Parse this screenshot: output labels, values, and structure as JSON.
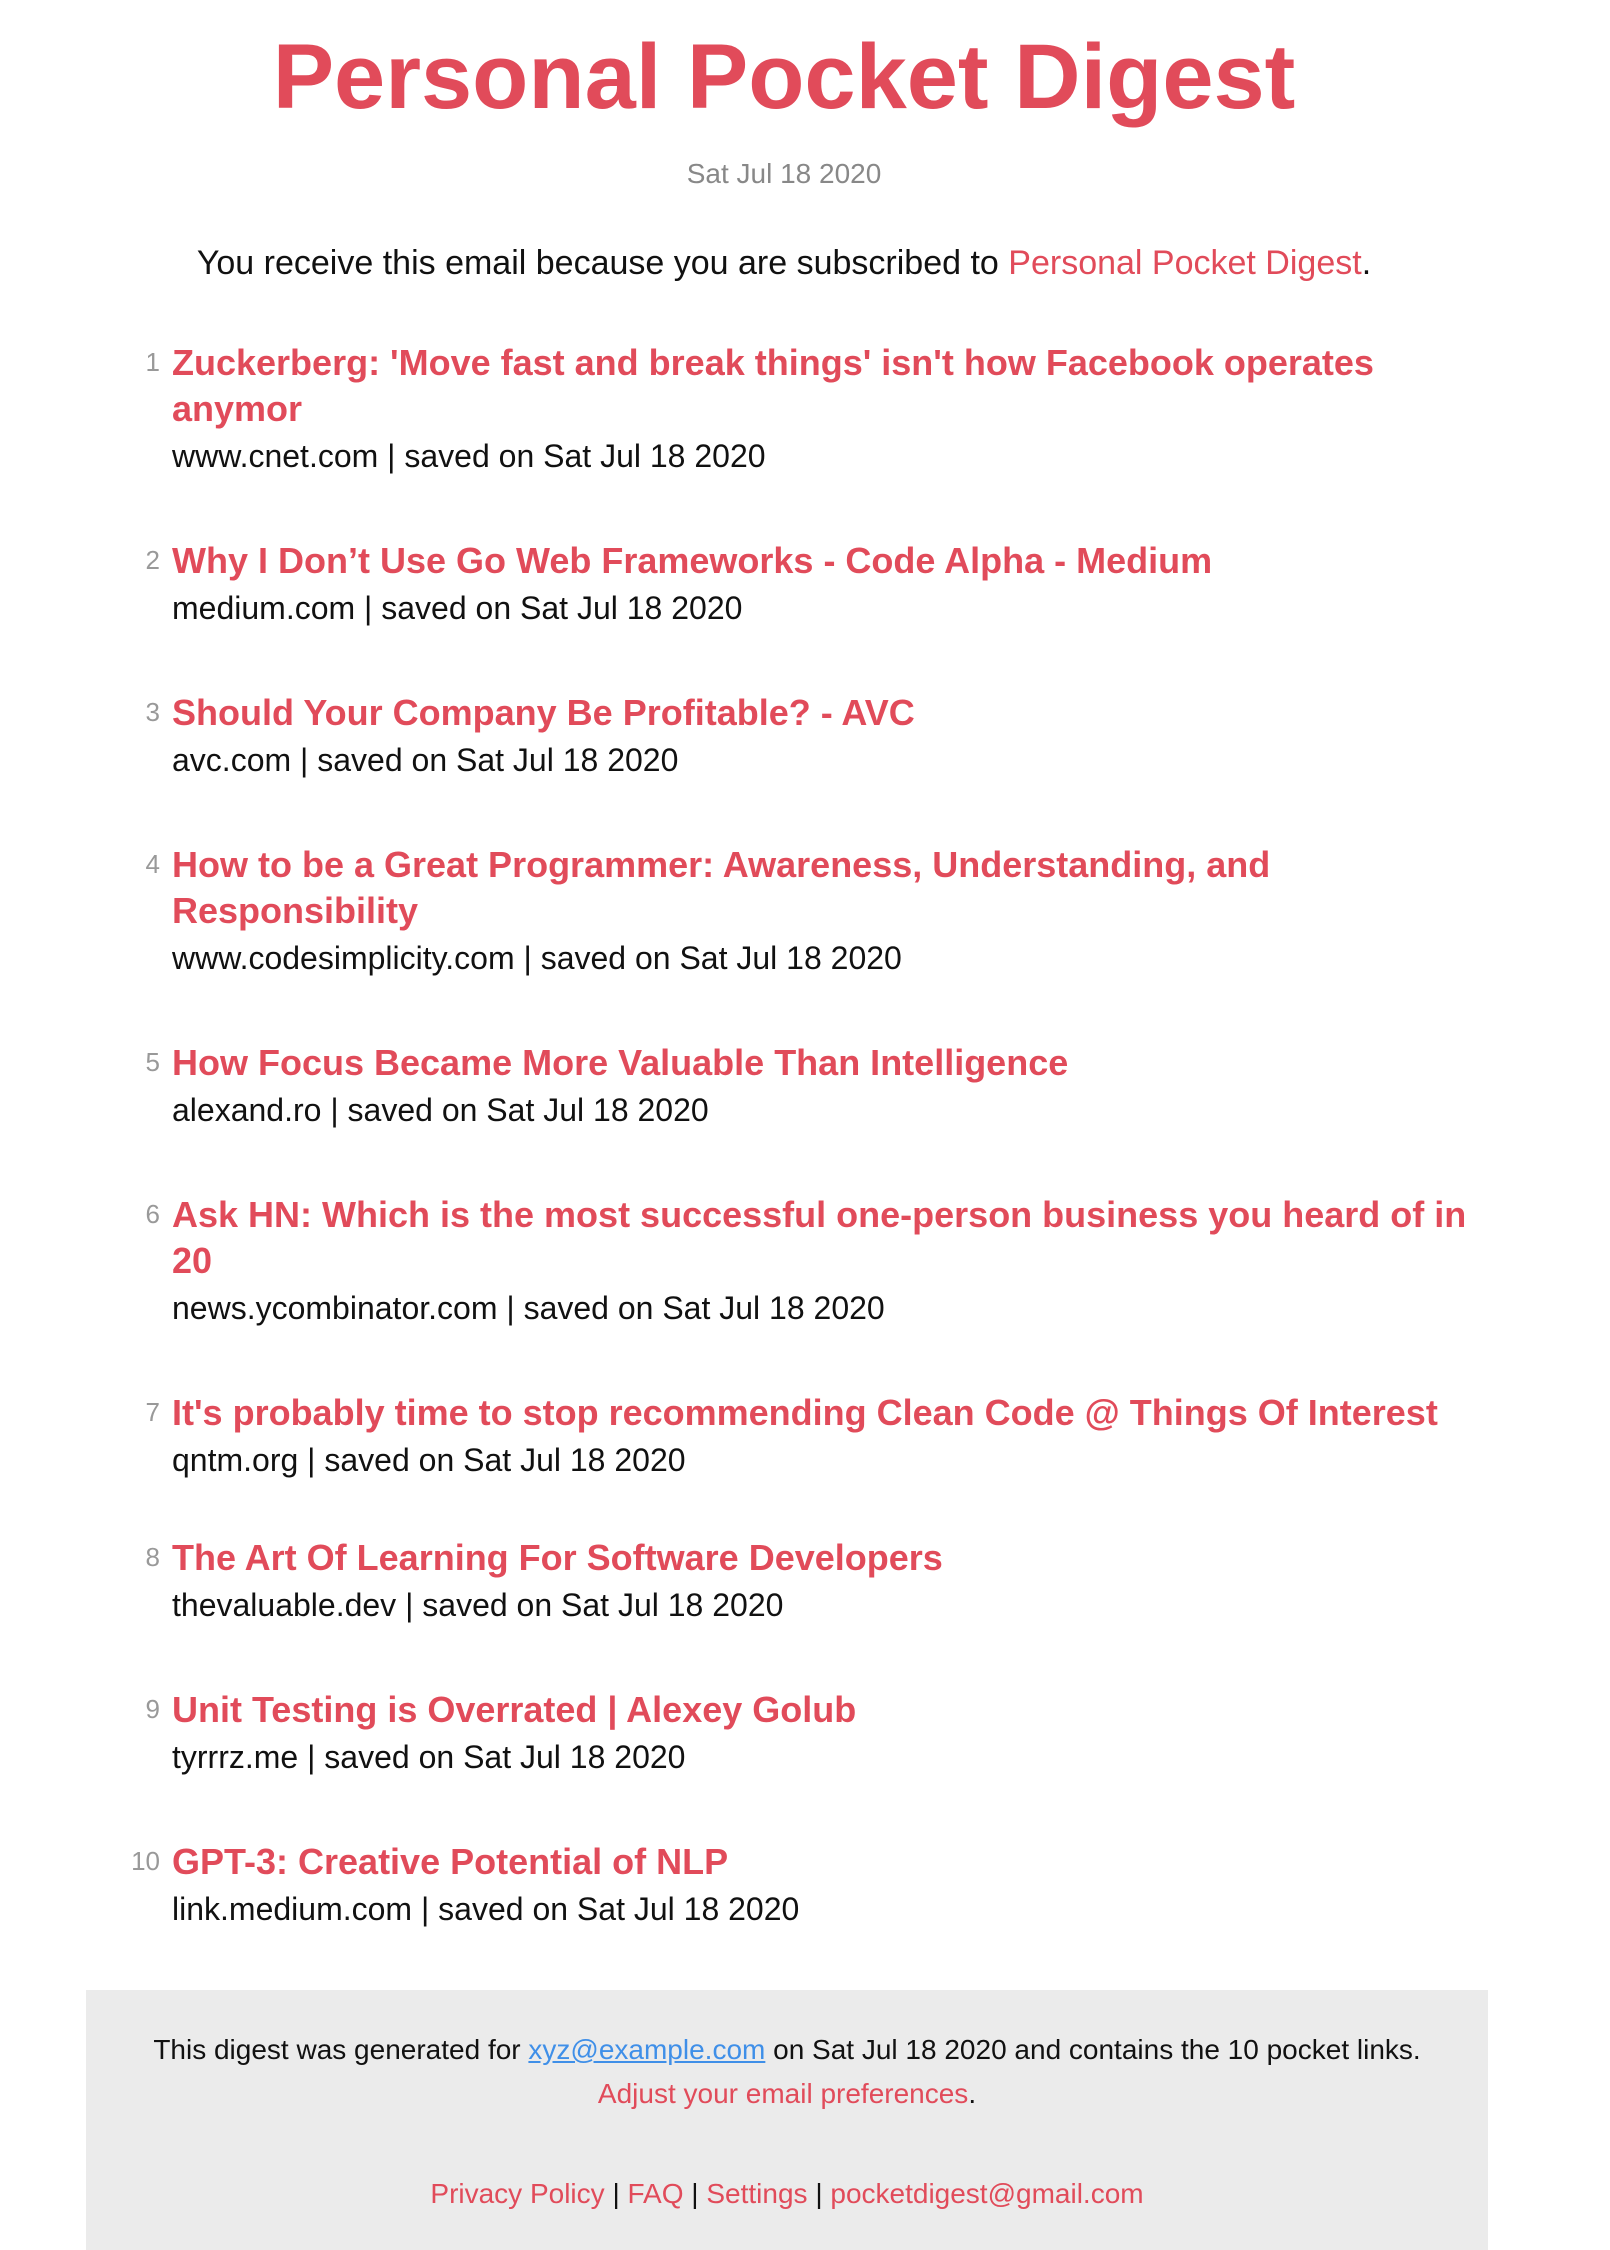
{
  "header": {
    "title": "Personal Pocket Digest",
    "date": "Sat Jul 18 2020"
  },
  "intro": {
    "prefix": "You receive this email because you are subscribed to ",
    "link_label": "Personal Pocket Digest",
    "suffix": "."
  },
  "items": [
    {
      "num": "1",
      "title": "Zuckerberg: 'Move fast and break things' isn't how Facebook operates anymor",
      "meta": "www.cnet.com | saved on Sat Jul 18 2020"
    },
    {
      "num": "2",
      "title": "Why I Don’t Use Go Web Frameworks - Code Alpha - Medium",
      "meta": "medium.com | saved on Sat Jul 18 2020"
    },
    {
      "num": "3",
      "title": "Should Your Company Be Profitable? - AVC",
      "meta": "avc.com | saved on Sat Jul 18 2020"
    },
    {
      "num": "4",
      "title": "How to be a Great Programmer: Awareness, Understanding, and Responsibility",
      "meta": "www.codesimplicity.com | saved on Sat Jul 18 2020"
    },
    {
      "num": "5",
      "title": "How Focus Became More Valuable Than Intelligence",
      "meta": "alexand.ro | saved on Sat Jul 18 2020"
    },
    {
      "num": "6",
      "title": "Ask HN: Which is the most successful one-person business you heard of in 20",
      "meta": "news.ycombinator.com | saved on Sat Jul 18 2020"
    },
    {
      "num": "7",
      "title": "It's probably time to stop recommending Clean Code @ Things Of Interest",
      "meta": "qntm.org | saved on Sat Jul 18 2020"
    },
    {
      "num": "8",
      "title": "The Art Of Learning For Software Developers",
      "meta": "thevaluable.dev | saved on Sat Jul 18 2020"
    },
    {
      "num": "9",
      "title": "Unit Testing is Overrated | Alexey Golub",
      "meta": "tyrrrz.me | saved on Sat Jul 18 2020"
    },
    {
      "num": "10",
      "title": "GPT-3: Creative Potential of NLP",
      "meta": "link.medium.com | saved on Sat Jul 18 2020"
    }
  ],
  "footer": {
    "text_prefix": "This digest was generated for ",
    "email": "xyz@example.com",
    "text_middle": " on Sat Jul 18 2020 and contains the 10 pocket links. ",
    "adjust_label": "Adjust your email preferences",
    "text_suffix": ".",
    "links": {
      "privacy": "Privacy Policy",
      "faq": "FAQ",
      "settings": "Settings",
      "contact": "pocketdigest@gmail.com",
      "separator": "|"
    }
  },
  "colors": {
    "accent": "#e14b5a",
    "email_link": "#3f8fe8",
    "footer_bg": "#ebebeb",
    "muted": "#888888"
  }
}
